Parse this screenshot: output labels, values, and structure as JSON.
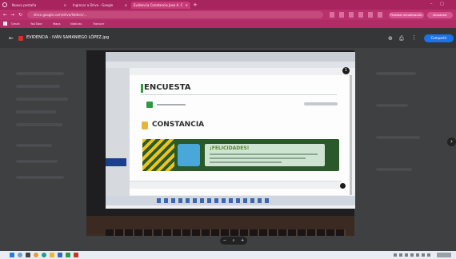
{
  "browser": {
    "tabs": [
      {
        "label": "Nueva pestaña",
        "active": false
      },
      {
        "label": "Ingresar a Drive - Google",
        "active": false
      },
      {
        "label": "Evidencia Constancia Jose A. C",
        "active": true
      }
    ],
    "url": "drive.google.com/drive/folders/...",
    "bookmarks": [
      "Gmail",
      "YouTube",
      "Maps",
      "Noticias",
      "Traducir"
    ],
    "profile_button": "Finalizar actualización",
    "update_button": "Actualizar"
  },
  "viewer": {
    "file_name": "EVIDENCIA - IVÁN SAMANIEGO LÓPEZ.jpg",
    "share_button": "Compartir",
    "zoom_minus": "−",
    "zoom_plus": "+"
  },
  "photo": {
    "section1_title": "ENCUESTA",
    "section2_title": "CONSTANCIA",
    "banner_title": "¡FELICIDADES!",
    "nav_badge": "1"
  }
}
